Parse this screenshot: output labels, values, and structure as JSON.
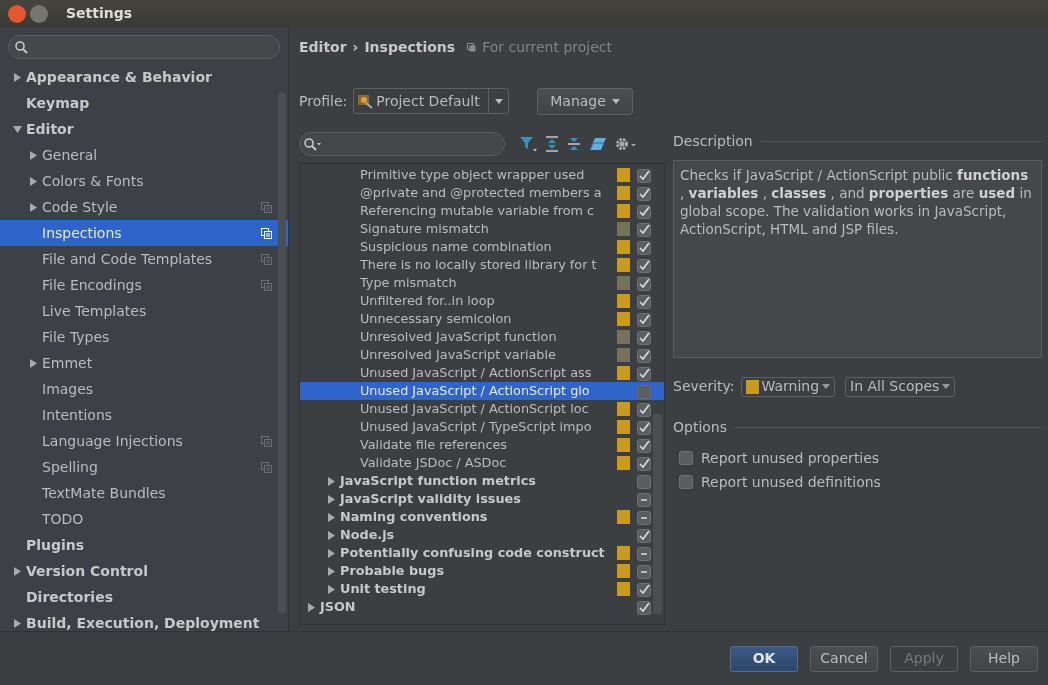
{
  "window": {
    "title": "Settings"
  },
  "sidebar": {
    "items": [
      {
        "label": "Appearance & Behavior",
        "kind": "group",
        "expanded": false,
        "selected": false,
        "project_scope": false
      },
      {
        "label": "Keymap",
        "kind": "leaf",
        "selected": false,
        "project_scope": false
      },
      {
        "label": "Editor",
        "kind": "group",
        "expanded": true,
        "selected": false,
        "project_scope": false,
        "children": [
          {
            "label": "General",
            "kind": "group",
            "expanded": false,
            "selected": false,
            "project_scope": false
          },
          {
            "label": "Colors & Fonts",
            "kind": "group",
            "expanded": false,
            "selected": false,
            "project_scope": false
          },
          {
            "label": "Code Style",
            "kind": "group",
            "expanded": false,
            "selected": false,
            "project_scope": true
          },
          {
            "label": "Inspections",
            "kind": "leaf",
            "selected": true,
            "project_scope": true
          },
          {
            "label": "File and Code Templates",
            "kind": "leaf",
            "selected": false,
            "project_scope": true
          },
          {
            "label": "File Encodings",
            "kind": "leaf",
            "selected": false,
            "project_scope": true
          },
          {
            "label": "Live Templates",
            "kind": "leaf",
            "selected": false,
            "project_scope": false
          },
          {
            "label": "File Types",
            "kind": "leaf",
            "selected": false,
            "project_scope": false
          },
          {
            "label": "Emmet",
            "kind": "group",
            "expanded": false,
            "selected": false,
            "project_scope": false
          },
          {
            "label": "Images",
            "kind": "leaf",
            "selected": false,
            "project_scope": false
          },
          {
            "label": "Intentions",
            "kind": "leaf",
            "selected": false,
            "project_scope": false
          },
          {
            "label": "Language Injections",
            "kind": "leaf",
            "selected": false,
            "project_scope": true
          },
          {
            "label": "Spelling",
            "kind": "leaf",
            "selected": false,
            "project_scope": true
          },
          {
            "label": "TextMate Bundles",
            "kind": "leaf",
            "selected": false,
            "project_scope": false
          },
          {
            "label": "TODO",
            "kind": "leaf",
            "selected": false,
            "project_scope": false
          }
        ]
      },
      {
        "label": "Plugins",
        "kind": "leaf",
        "selected": false,
        "project_scope": false
      },
      {
        "label": "Version Control",
        "kind": "group",
        "expanded": false,
        "selected": false,
        "project_scope": false
      },
      {
        "label": "Directories",
        "kind": "leaf",
        "selected": false,
        "project_scope": false
      },
      {
        "label": "Build, Execution, Deployment",
        "kind": "group",
        "expanded": false,
        "selected": false,
        "project_scope": false
      }
    ]
  },
  "breadcrumb": {
    "parent": "Editor",
    "separator": "›",
    "current": "Inspections",
    "scope": "For current project"
  },
  "profile": {
    "label": "Profile:",
    "value": "Project Default",
    "manage": "Manage"
  },
  "inspection_tree": [
    {
      "children": [
        {
          "children": [
            {
              "label": "Primitive type object wrapper used",
              "kind": "leaf",
              "color": "#c99a1c",
              "checked": true,
              "partially_checked": false,
              "selected": false
            },
            {
              "label": "@private and @protected members a",
              "kind": "leaf",
              "color": "#c99a1c",
              "checked": true,
              "partially_checked": false,
              "selected": false
            },
            {
              "label": "Referencing mutable variable from c",
              "kind": "leaf",
              "color": "#c99a1c",
              "checked": true,
              "partially_checked": false,
              "selected": false
            },
            {
              "label": "Signature mismatch",
              "kind": "leaf",
              "color": "#77705a",
              "checked": true,
              "partially_checked": false,
              "selected": false
            },
            {
              "label": "Suspicious name combination",
              "kind": "leaf",
              "color": "#c99a1c",
              "checked": true,
              "partially_checked": false,
              "selected": false
            },
            {
              "label": "There is no locally stored library for t",
              "kind": "leaf",
              "color": "#c99a1c",
              "checked": true,
              "partially_checked": false,
              "selected": false
            },
            {
              "label": "Type mismatch",
              "kind": "leaf",
              "color": "#77705a",
              "checked": true,
              "partially_checked": false,
              "selected": false
            },
            {
              "label": "Unfiltered for..in loop",
              "kind": "leaf",
              "color": "#c99a1c",
              "checked": true,
              "partially_checked": false,
              "selected": false
            },
            {
              "label": "Unnecessary semicolon",
              "kind": "leaf",
              "color": "#c99a1c",
              "checked": true,
              "partially_checked": false,
              "selected": false
            },
            {
              "label": "Unresolved JavaScript function",
              "kind": "leaf",
              "color": "#77705a",
              "checked": true,
              "partially_checked": false,
              "selected": false
            },
            {
              "label": "Unresolved JavaScript variable",
              "kind": "leaf",
              "color": "#77705a",
              "checked": true,
              "partially_checked": false,
              "selected": false
            },
            {
              "label": "Unused JavaScript / ActionScript ass",
              "kind": "leaf",
              "color": "#c99a1c",
              "checked": true,
              "partially_checked": false,
              "selected": false
            },
            {
              "label": "Unused JavaScript / ActionScript glo",
              "kind": "leaf",
              "checked": false,
              "partially_checked": false,
              "selected": true
            },
            {
              "label": "Unused JavaScript / ActionScript loc",
              "kind": "leaf",
              "color": "#c99a1c",
              "checked": true,
              "partially_checked": false,
              "selected": false
            },
            {
              "label": "Unused JavaScript / TypeScript impo",
              "kind": "leaf",
              "color": "#c99a1c",
              "checked": true,
              "partially_checked": false,
              "selected": false
            },
            {
              "label": "Validate file references",
              "kind": "leaf",
              "color": "#c99a1c",
              "checked": true,
              "partially_checked": false,
              "selected": false
            },
            {
              "label": "Validate JSDoc / ASDoc",
              "kind": "leaf",
              "color": "#c99a1c",
              "checked": true,
              "partially_checked": false,
              "selected": false
            }
          ]
        },
        {
          "label": "JavaScript function metrics",
          "kind": "group",
          "expanded": false,
          "checked": false,
          "partially_checked": false,
          "selected": false
        },
        {
          "label": "JavaScript validity issues",
          "kind": "group",
          "expanded": false,
          "partially_checked": true,
          "selected": false
        },
        {
          "label": "Naming conventions",
          "kind": "group",
          "expanded": false,
          "color": "#c99a1c",
          "partially_checked": true,
          "selected": false
        },
        {
          "label": "Node.js",
          "kind": "group",
          "expanded": false,
          "checked": true,
          "partially_checked": false,
          "selected": false
        },
        {
          "label": "Potentially confusing code construct",
          "kind": "group",
          "expanded": false,
          "color": "#c99a1c",
          "partially_checked": true,
          "selected": false
        },
        {
          "label": "Probable bugs",
          "kind": "group",
          "expanded": false,
          "color": "#c99a1c",
          "partially_checked": true,
          "selected": false
        },
        {
          "label": "Unit testing",
          "kind": "group",
          "expanded": false,
          "color": "#c99a1c",
          "checked": true,
          "partially_checked": false,
          "selected": false
        }
      ]
    },
    {
      "label": "JSON",
      "kind": "group",
      "expanded": false,
      "checked": true,
      "partially_checked": false,
      "selected": false
    }
  ],
  "description": {
    "title": "Description",
    "text": "Checks if JavaScript / ActionScript public **functions** , **variables** , **classes** , and **properties** are **used** in global scope. The validation works in JavaScript, ActionScript, HTML and JSP files."
  },
  "severity": {
    "label": "Severity:",
    "value": "Warning",
    "color": "#c99a1c",
    "scope": "In All Scopes"
  },
  "options": {
    "title": "Options",
    "items": [
      {
        "label": "Report unused properties",
        "checked": false
      },
      {
        "label": "Report unused definitions",
        "checked": false
      }
    ]
  },
  "buttons": [
    {
      "label": "OK",
      "kind": "default",
      "disabled": false
    },
    {
      "label": "Cancel",
      "kind": "normal",
      "disabled": false
    },
    {
      "label": "Apply",
      "kind": "normal",
      "disabled": true
    },
    {
      "label": "Help",
      "kind": "normal",
      "disabled": false
    }
  ]
}
